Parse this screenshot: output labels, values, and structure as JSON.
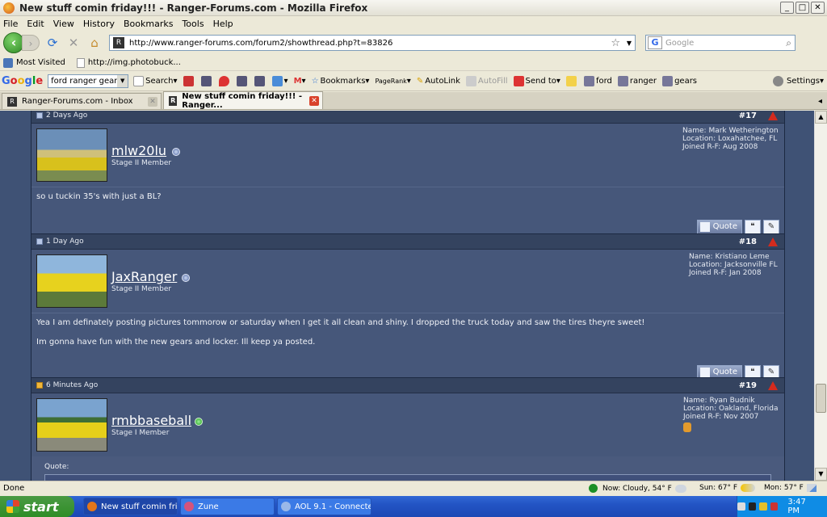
{
  "window": {
    "title": "New stuff comin friday!!! - Ranger-Forums.com - Mozilla Firefox"
  },
  "menu": [
    "File",
    "Edit",
    "View",
    "History",
    "Bookmarks",
    "Tools",
    "Help"
  ],
  "nav": {
    "url": "http://www.ranger-forums.com/forum2/showthread.php?t=83826",
    "search_placeholder": "Google"
  },
  "bookmarks": [
    "Most Visited",
    "http://img.photobuck..."
  ],
  "google_toolbar": {
    "query": "ford ranger gears",
    "search_label": "Search",
    "bookmarks_label": "Bookmarks",
    "pagerank_label": "PageRank",
    "autolink_label": "AutoLink",
    "autofill_label": "AutoFill",
    "sendto_label": "Send to",
    "terms": [
      "ford",
      "ranger",
      "gears"
    ],
    "settings_label": "Settings"
  },
  "tabs": [
    {
      "label": "Ranger-Forums.com - Inbox"
    },
    {
      "label": "New stuff comin friday!!! - Ranger..."
    }
  ],
  "posts": [
    {
      "time": "2 Days Ago",
      "number": "#17",
      "username": "mlw20lu",
      "rank": "Stage II Member",
      "name": "Name: Mark Wetherington",
      "location": "Location: Loxahatchee, FL",
      "joined": "Joined R-F: Aug 2008",
      "message": [
        "so u tuckin 35's with just a BL?"
      ],
      "quote_label": "Quote"
    },
    {
      "time": "1 Day Ago",
      "number": "#18",
      "username": "JaxRanger",
      "rank": "Stage II Member",
      "name": "Name: Kristiano Leme",
      "location": "Location: Jacksonville FL",
      "joined": "Joined R-F: Jan 2008",
      "message": [
        "Yea I am definately posting pictures tommorow or saturday when I get it all clean and shiny. I dropped the truck today and saw the tires theyre sweet!",
        "Im gonna have fun with the new gears and locker. Ill keep ya posted."
      ],
      "quote_label": "Quote"
    },
    {
      "time": "6 Minutes Ago",
      "number": "#19",
      "username": "rmbbaseball",
      "rank": "Stage I Member",
      "name": "Name: Ryan Budnik",
      "location": "Location: Oakland, Florida",
      "joined": "Joined R-F: Nov 2007",
      "quote_intro": "Quote:"
    }
  ],
  "status": {
    "text": "Done",
    "weather_now": "Now: Cloudy, 54° F",
    "weather_sun": "Sun: 67° F",
    "weather_mon": "Mon: 57° F"
  },
  "taskbar": {
    "start": "start",
    "tasks": [
      "New stuff comin frida...",
      "Zune",
      "AOL 9.1 - Connected..."
    ],
    "clock": "3:47 PM"
  }
}
